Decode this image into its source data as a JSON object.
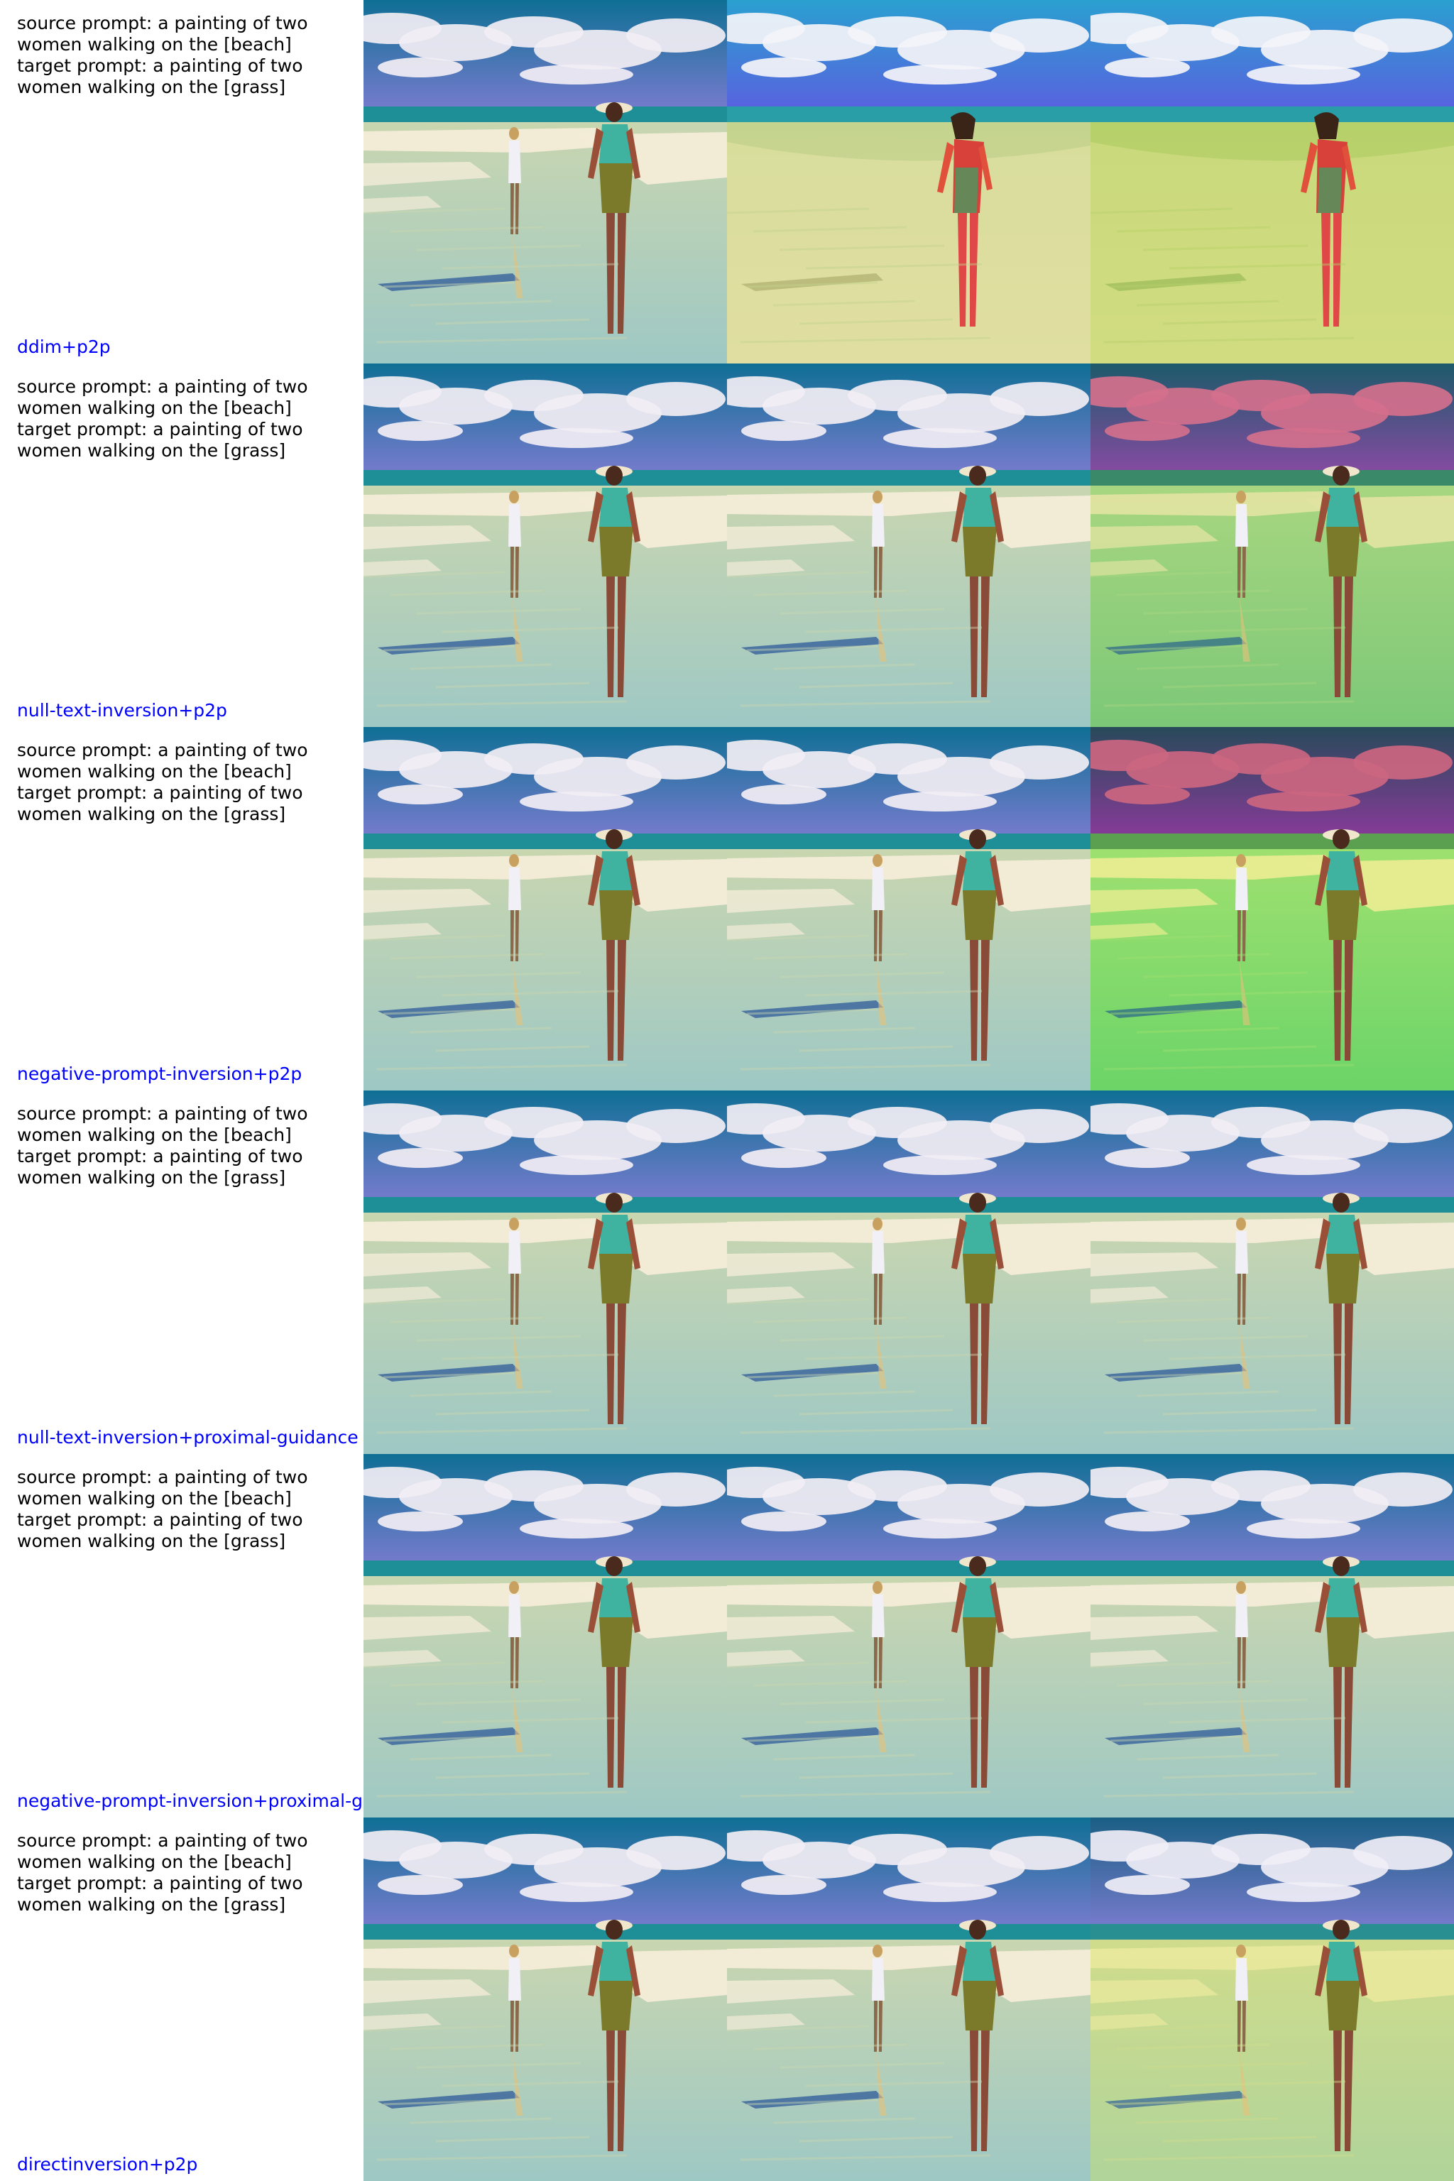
{
  "colors": {
    "method_label": "#0000ff",
    "prompt_text": "#000000",
    "background": "#ffffff"
  },
  "rows": [
    {
      "source_prompt": "source prompt: a painting of two\nwomen walking on the [beach]",
      "target_prompt": "target prompt: a painting of two\nwomen walking on the [grass]",
      "method": "ddim+p2p",
      "images": [
        {
          "description": "original beach painting",
          "style": "beach"
        },
        {
          "description": "edited: single woman on sandy beach",
          "style": "sand-single"
        },
        {
          "description": "edited: single woman on grassy field",
          "style": "grass-single"
        }
      ]
    },
    {
      "source_prompt": "source prompt: a painting of two\nwomen walking on the [beach]",
      "target_prompt": "target prompt: a painting of two\nwomen walking on the [grass]",
      "method": "null-text-inversion+p2p",
      "images": [
        {
          "description": "original beach painting",
          "style": "beach"
        },
        {
          "description": "reconstruction",
          "style": "beach"
        },
        {
          "description": "edited: green grass",
          "style": "grass-green"
        }
      ]
    },
    {
      "source_prompt": "source prompt: a painting of two\nwomen walking on the [beach]",
      "target_prompt": "target prompt: a painting of two\nwomen walking on the [grass]",
      "method": "negative-prompt-inversion+p2p",
      "images": [
        {
          "description": "original beach painting",
          "style": "beach"
        },
        {
          "description": "reconstruction",
          "style": "beach"
        },
        {
          "description": "edited: bright green grass",
          "style": "grass-bright"
        }
      ]
    },
    {
      "source_prompt": "source prompt: a painting of two\nwomen walking on the [beach]",
      "target_prompt": "target prompt: a painting of two\nwomen walking on the [grass]",
      "method": "null-text-inversion+proximal-guidance",
      "images": [
        {
          "description": "original beach painting",
          "style": "beach"
        },
        {
          "description": "reconstruction",
          "style": "beach"
        },
        {
          "description": "edited: mostly unchanged",
          "style": "beach"
        }
      ]
    },
    {
      "source_prompt": "source prompt: a painting of two\nwomen walking on the [beach]",
      "target_prompt": "target prompt: a painting of two\nwomen walking on the [grass]",
      "method": "negative-prompt-inversion+proximal-g",
      "images": [
        {
          "description": "original beach painting",
          "style": "beach"
        },
        {
          "description": "reconstruction",
          "style": "beach"
        },
        {
          "description": "edited: mostly unchanged",
          "style": "beach"
        }
      ]
    },
    {
      "source_prompt": "source prompt: a painting of two\nwomen walking on the [beach]",
      "target_prompt": "target prompt: a painting of two\nwomen walking on the [grass]",
      "method": "directinversion+p2p",
      "images": [
        {
          "description": "original beach painting",
          "style": "beach"
        },
        {
          "description": "reconstruction",
          "style": "beach"
        },
        {
          "description": "edited: light yellow-green grass",
          "style": "grass-light"
        }
      ]
    }
  ]
}
